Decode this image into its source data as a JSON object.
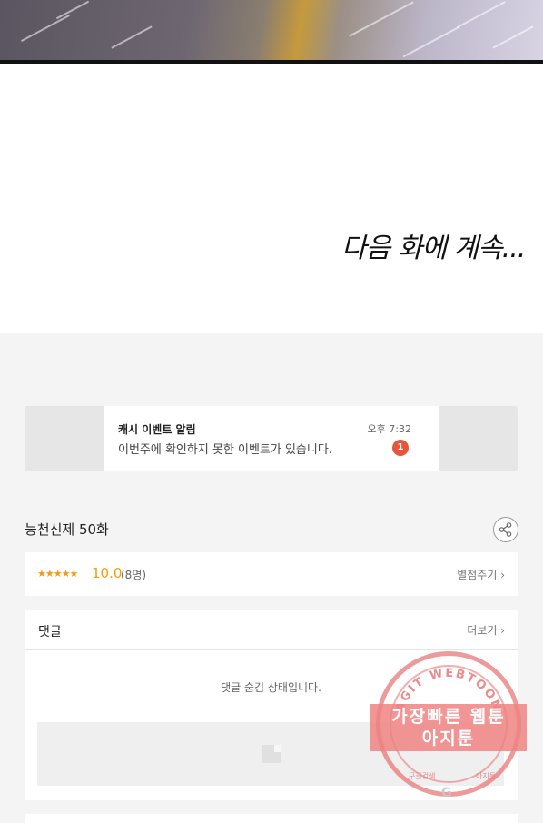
{
  "comic": {
    "continued_text": "다음 화에 계속..."
  },
  "notification": {
    "title": "캐시 이벤트 알림",
    "time": "오후 7:32",
    "message": "이번주에 확인하지 못한 이벤트가 있습니다.",
    "badge_count": "1",
    "badge_color": "#e8553a"
  },
  "episode": {
    "title": "능천신제 50화",
    "share_icon": "share-icon"
  },
  "rating": {
    "stars": "★★★★★",
    "score": "10.0",
    "raters": "(8명)",
    "rate_link": "별점주기 ›",
    "accent_color": "#f39c12"
  },
  "comments": {
    "title": "댓글",
    "more_link": "더보기 ›",
    "hidden_message": "댓글 숨김 상태입니다."
  },
  "watermark": {
    "arc_text": "AGIT WEBTOON",
    "line1": "가장빠른 웹툰",
    "line2": "아지툰",
    "footer_left": "구글검색",
    "footer_right": "아지툰"
  }
}
